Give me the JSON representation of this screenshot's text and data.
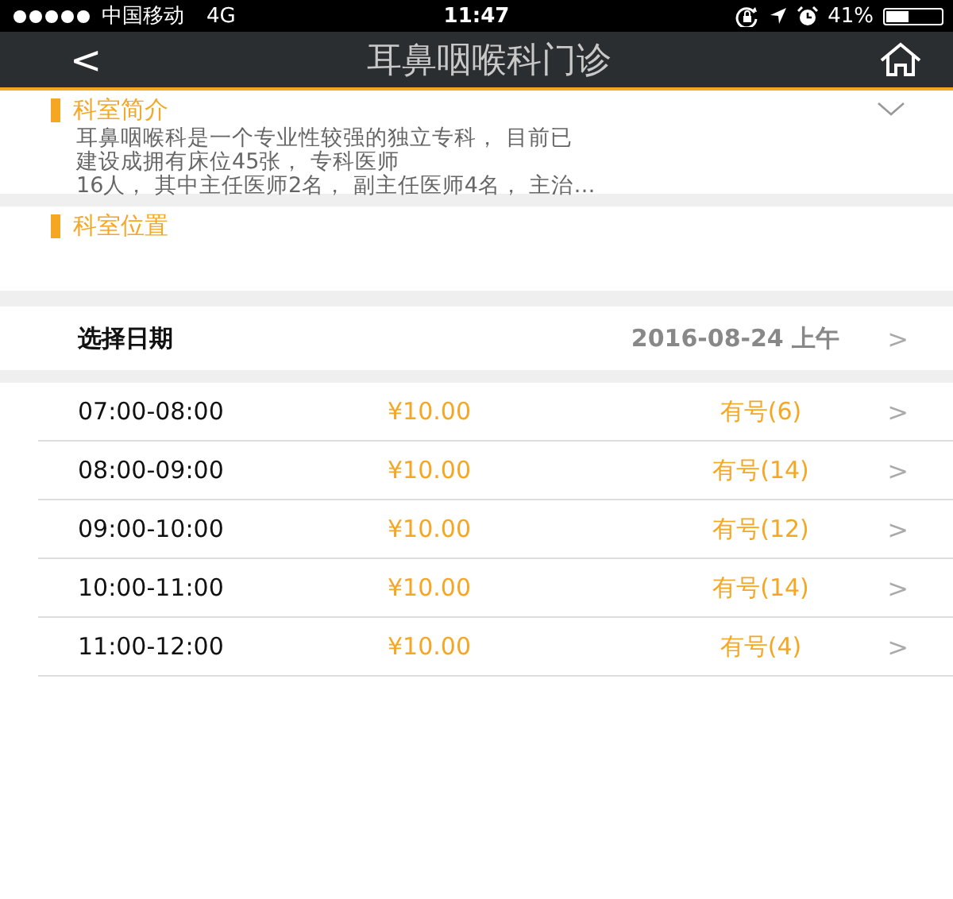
{
  "status_bar": {
    "carrier": "中国移动",
    "network": "4G",
    "time": "11:47",
    "battery_percent": "41%"
  },
  "nav": {
    "back": "<",
    "title": "耳鼻咽喉科门诊"
  },
  "intro": {
    "heading": "科室简介",
    "expanded": false,
    "lines": [
      "耳鼻咽喉科是一个专业性较强的独立专科， 目前已",
      "建设成拥有床位45张， 专科医师",
      "16人， 其中主任医师2名， 副主任医师4名， 主治…"
    ]
  },
  "location": {
    "heading": "科室位置"
  },
  "date_row": {
    "label": "选择日期",
    "value": "2016-08-24 上午",
    "chevron": ">"
  },
  "slots": [
    {
      "time": "07:00-08:00",
      "price": "¥10.00",
      "availability": "有号(6)",
      "chevron": ">"
    },
    {
      "time": "08:00-09:00",
      "price": "¥10.00",
      "availability": "有号(14)",
      "chevron": ">"
    },
    {
      "time": "09:00-10:00",
      "price": "¥10.00",
      "availability": "有号(12)",
      "chevron": ">"
    },
    {
      "time": "10:00-11:00",
      "price": "¥10.00",
      "availability": "有号(14)",
      "chevron": ">"
    },
    {
      "time": "11:00-12:00",
      "price": "¥10.00",
      "availability": "有号(4)",
      "chevron": ">"
    }
  ]
}
